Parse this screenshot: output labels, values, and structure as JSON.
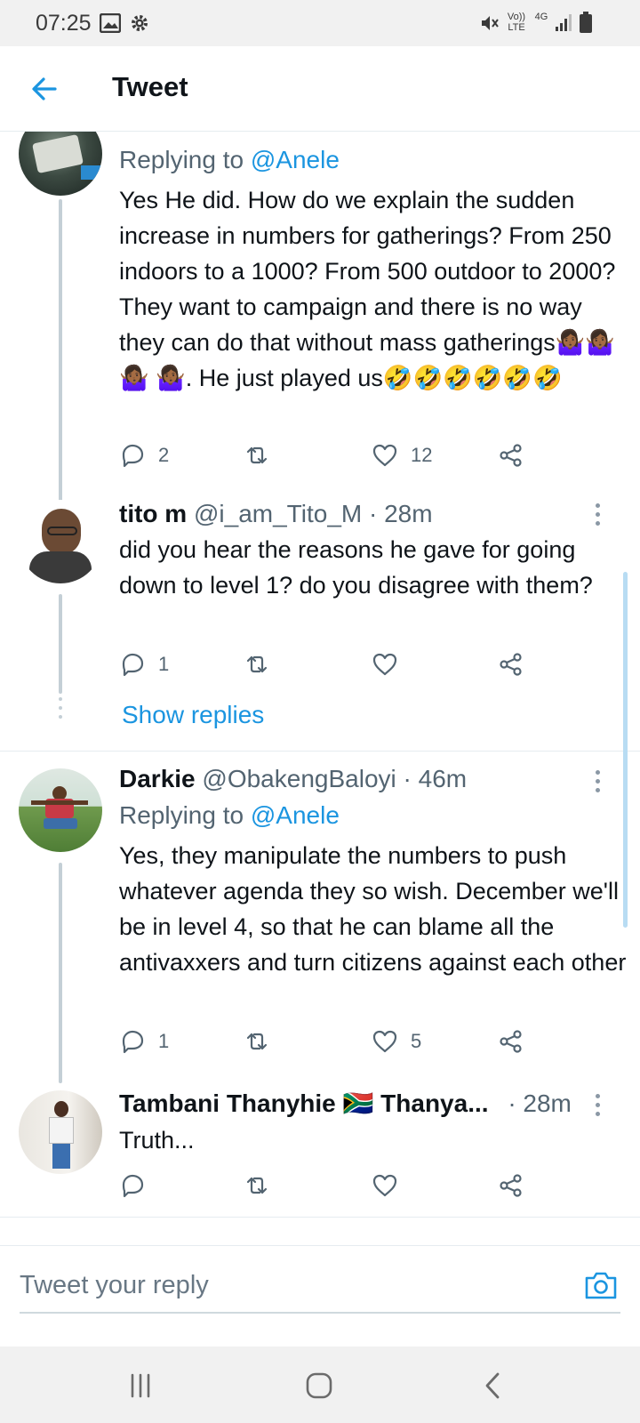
{
  "status_bar": {
    "time": "07:25",
    "icons": [
      "image-icon",
      "gear-icon",
      "mute-icon",
      "volte-icon",
      "4g-icon",
      "signal-icon",
      "battery-icon"
    ],
    "volte_label": "Vo)) LTE",
    "network_label": "4G"
  },
  "header": {
    "title": "Tweet",
    "back_icon": "back-arrow-icon"
  },
  "colors": {
    "accent": "#1b95e0",
    "muted": "#536471",
    "line": "#c4cfd6"
  },
  "tweets": [
    {
      "replying_label": "Replying to",
      "replying_handle": "@Anele",
      "text_1": "Yes He did. How do we explain the sudden increase in numbers for gatherings? From 250 indoors to a 1000? From 500 outdoor to 2000? They want to campaign and there is no way they can do that without mass gatherings🤷🏾‍♀️🤷🏾‍♀️🤷🏾‍♀️",
      "text_2": "🤷🏾‍♀️. He just played us🤣🤣🤣🤣🤣🤣",
      "replies": "2",
      "retweets": "",
      "likes": "12"
    },
    {
      "name": "tito m",
      "handle": "@i_am_Tito_M",
      "time": "· 28m",
      "text": "did you hear the reasons he gave for going down to level 1? do you disagree with them?",
      "replies": "1",
      "retweets": "",
      "likes": ""
    },
    {
      "name": "Darkie",
      "handle": "@ObakengBaloyi",
      "time": "· 46m",
      "replying_label": "Replying to",
      "replying_handle": "@Anele",
      "text": "Yes, they manipulate the numbers to push whatever agenda they so wish. December we'll be in level 4, so that he can blame all the antivaxxers and turn citizens against each other",
      "replies": "1",
      "retweets": "",
      "likes": "5"
    },
    {
      "name": "Tambani Thanyhie 🇿🇦 Thanya...",
      "time": "· 28m",
      "text": "Truth...",
      "replies": "",
      "retweets": "",
      "likes": ""
    }
  ],
  "show_replies": "Show replies",
  "composer": {
    "placeholder": "Tweet your reply"
  }
}
